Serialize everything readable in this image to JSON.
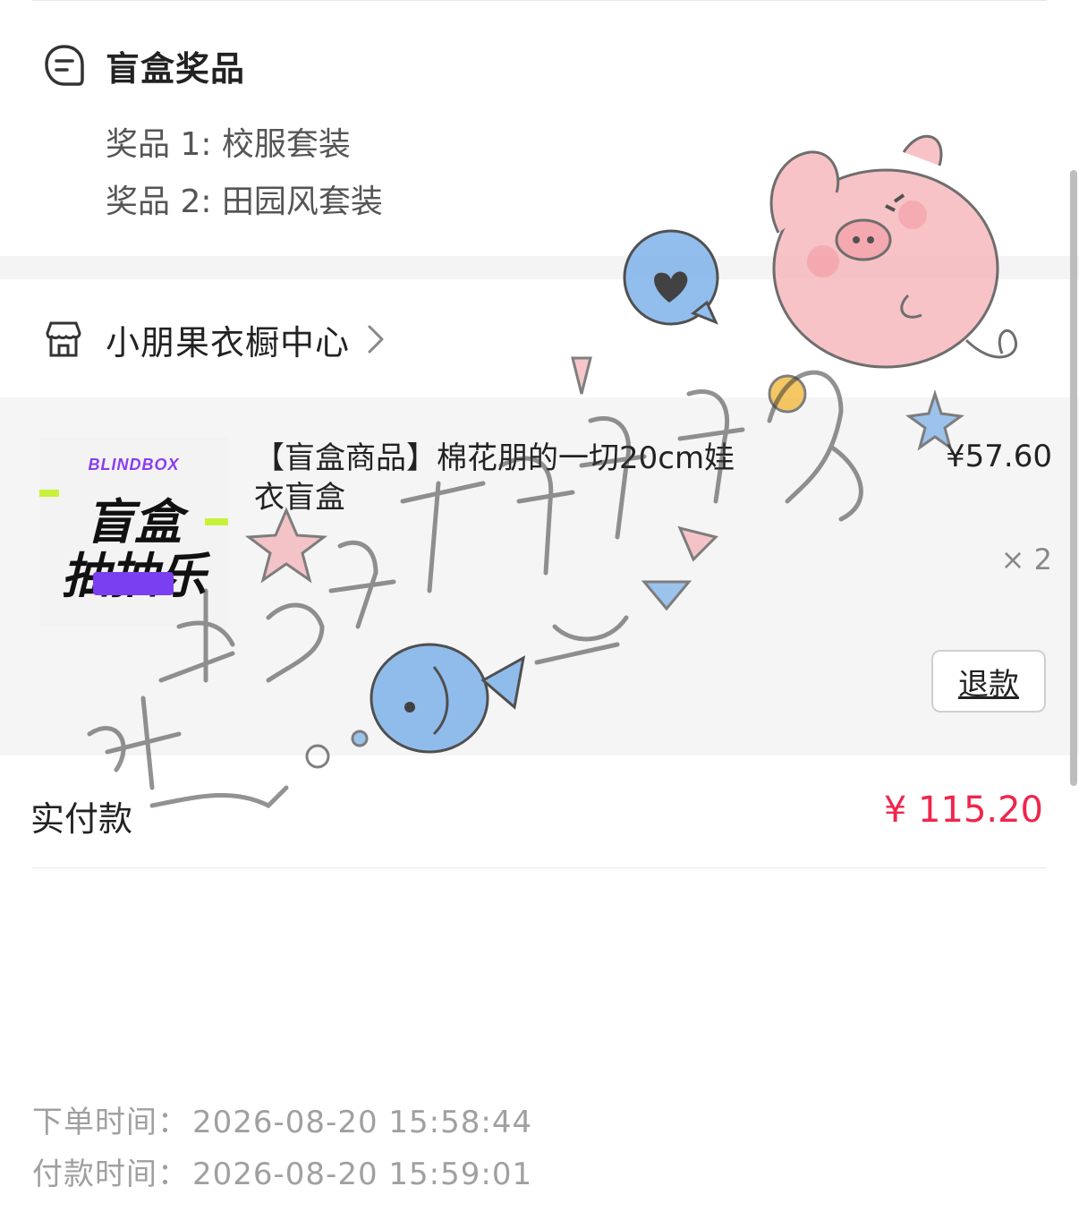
{
  "prizes": {
    "title": "盲盒奖品",
    "items": [
      "奖品 1: 校服套装",
      "奖品 2: 田园风套装"
    ]
  },
  "shop": {
    "name": "小朋果衣橱中心"
  },
  "product": {
    "thumbnail_tag": "BLINDBOX",
    "thumbnail_line1": "盲盒",
    "thumbnail_line2": "抽抽乐",
    "title": "【盲盒商品】棉花朋的一切20cm娃衣盲盒",
    "price": "¥57.60",
    "quantity": "× 2",
    "refund_label": "退款"
  },
  "payment": {
    "label": "实付款",
    "amount": "¥ 115.20"
  },
  "times": {
    "order_label": "下单时间：",
    "order_value": "2026-08-20 15:58:44",
    "pay_label": "付款时间：",
    "pay_value": "2026-08-20 15:59:01"
  },
  "colors": {
    "amount": "#f0254c",
    "muted": "#a0a0a0",
    "section_bg": "#f5f5f5"
  },
  "icons": {
    "prize": "note-icon",
    "shop": "store-icon",
    "chevron": "chevron-right-icon"
  }
}
